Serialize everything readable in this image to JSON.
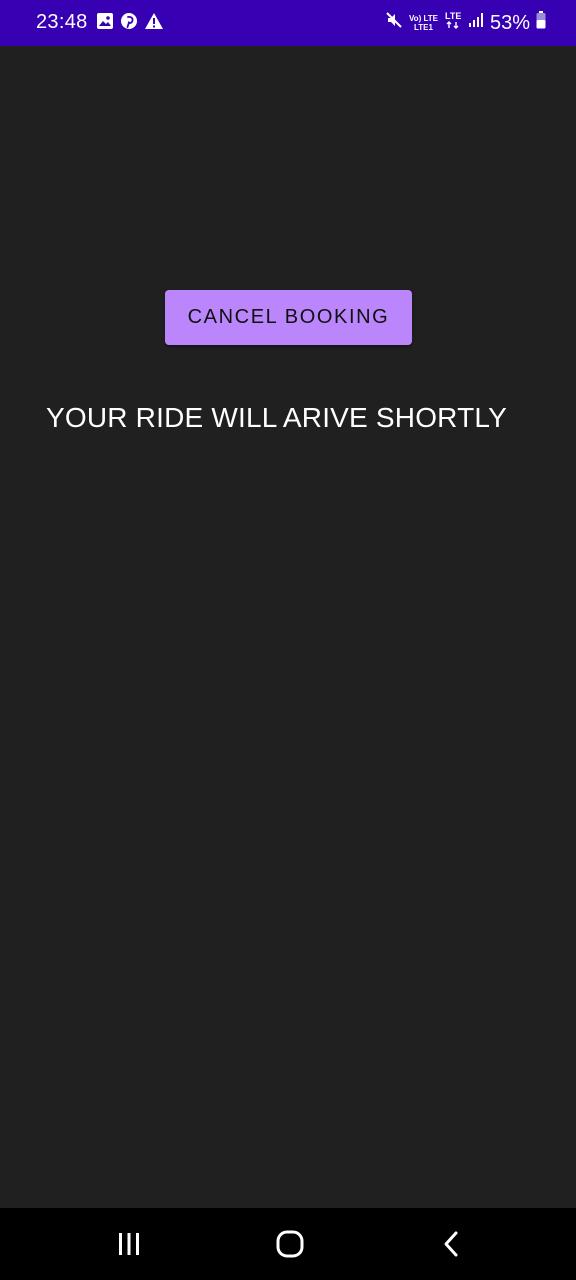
{
  "status_bar": {
    "time": "23:48",
    "left_icons": [
      "gallery-icon",
      "pinterest-icon",
      "warning-icon"
    ],
    "network_top": "Vo) LTE",
    "network_bottom": "LTE1",
    "battery": "53%",
    "background": "#3700b3"
  },
  "main": {
    "cancel_button_label": "CANCEL BOOKING",
    "message": "YOUR RIDE WILL ARIVE SHORTLY",
    "button_color": "#bb86fc",
    "background": "#212021"
  },
  "nav_bar": {
    "buttons": [
      "recent-apps-icon",
      "home-icon",
      "back-icon"
    ]
  }
}
